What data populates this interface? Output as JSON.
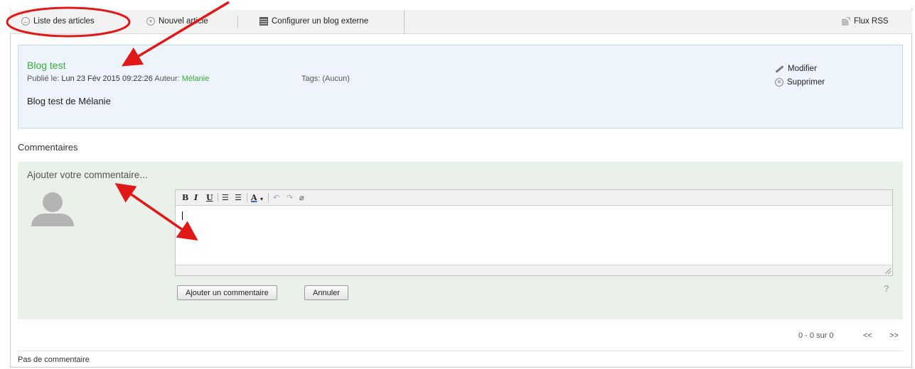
{
  "toolbar": {
    "list_label": "Liste des articles",
    "new_label": "Nouvel article",
    "external_label": "Configurer un blog externe",
    "rss_label": "Flux RSS"
  },
  "article": {
    "title": "Blog test",
    "published_prefix": "Publié le:",
    "published_date": "Lun 23 Fév 2015 09:22:26",
    "author_prefix": "Auteur:",
    "author": "Mélanie",
    "tags": "Tags: (Aucun)",
    "body": "Blog test de Mélanie",
    "edit_label": "Modifier",
    "delete_label": "Supprimer"
  },
  "comments": {
    "heading": "Commentaires",
    "add_title": "Ajouter votre commentaire...",
    "editor_buttons": [
      "B",
      "I",
      "U",
      "ordered-list",
      "unordered-list",
      "A",
      "undo",
      "redo",
      "clear-format"
    ],
    "submit_label": "Ajouter un commentaire",
    "cancel_label": "Annuler",
    "help": "?",
    "no_comments": "Pas de commentaire"
  },
  "pagination": {
    "range": "0 - 0 sur 0",
    "prev": "<<",
    "next": ">>"
  },
  "colors": {
    "accent_green": "#3aaa35",
    "annotation_red": "#e01818"
  }
}
